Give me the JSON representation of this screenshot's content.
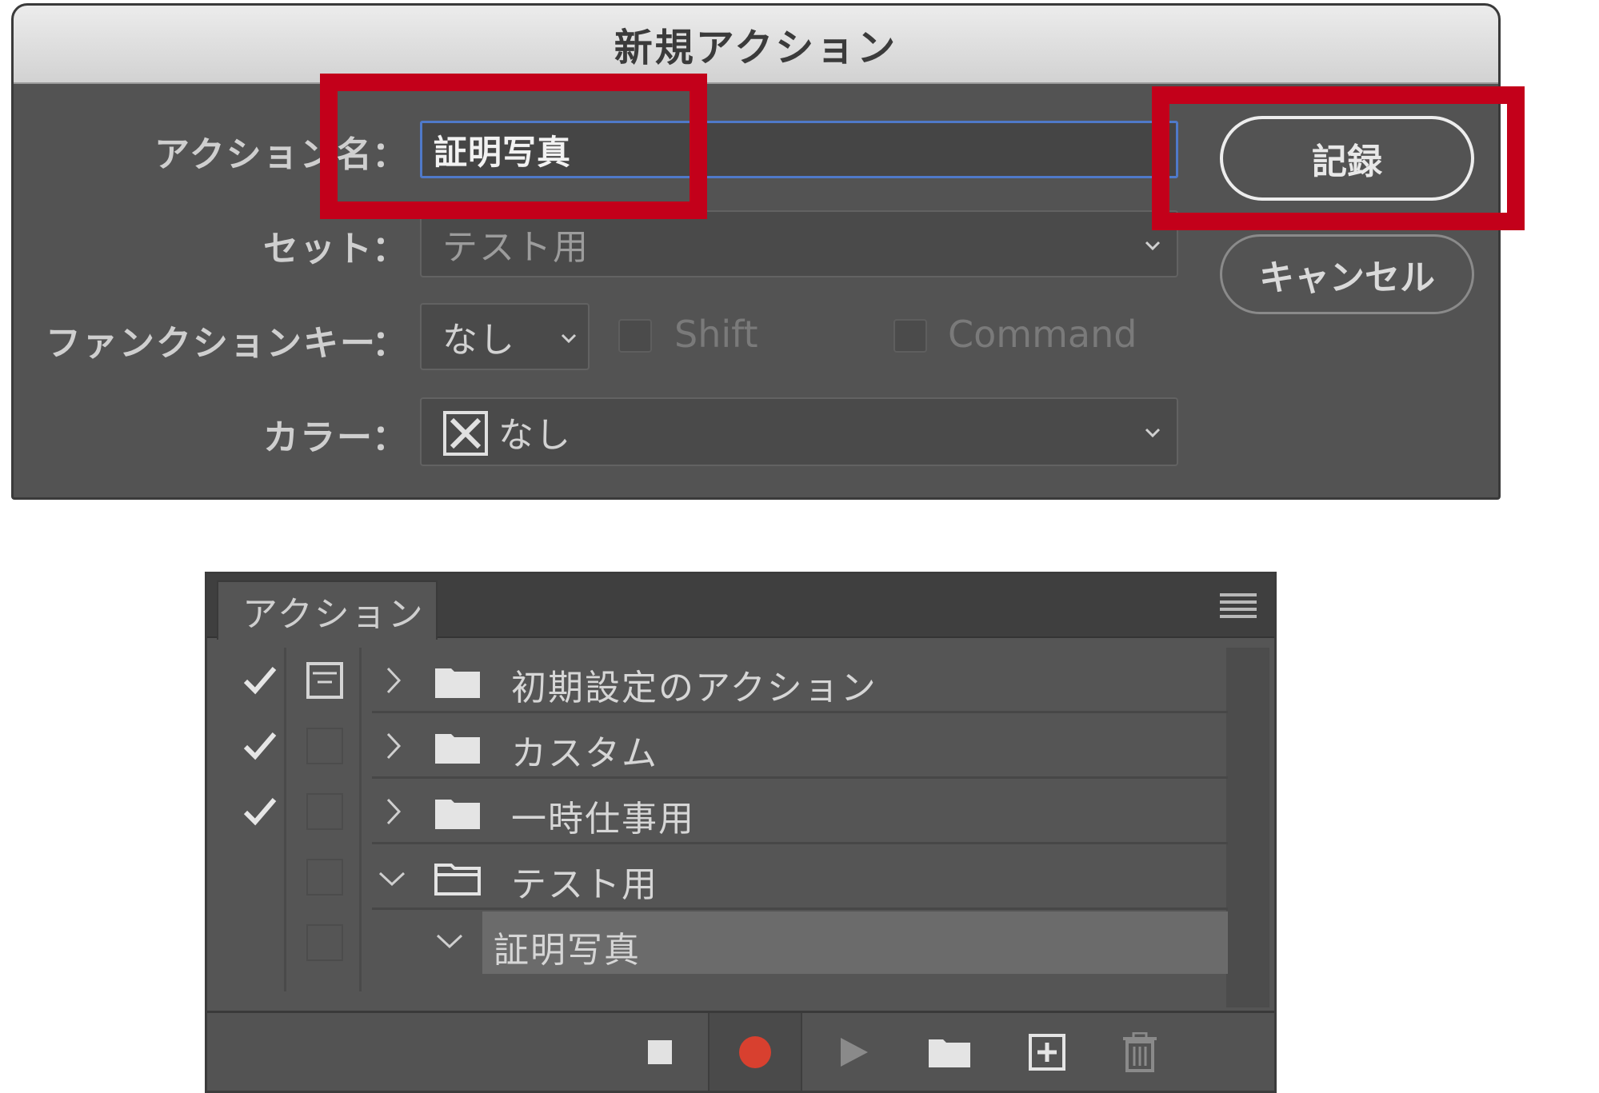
{
  "dialog": {
    "title": "新規アクション",
    "name_label": "アクション名",
    "name_value": "証明写真",
    "set_label": "セット",
    "set_value": "テスト用",
    "function_key_label": "ファンクションキー",
    "function_key_value": "なし",
    "shift_label": "Shift",
    "command_label": "Command",
    "color_label": "カラー",
    "color_value": "なし",
    "colon": "：",
    "record_button": "記録",
    "cancel_button": "キャンセル",
    "highlight_color": "#c3001a",
    "input_focus_color": "#4f79c9"
  },
  "panel": {
    "tab_label": "アクション",
    "rows": [
      {
        "label": "初期設定のアクション",
        "checked": true,
        "dialog_toggle": true,
        "expanded": false,
        "selected": false
      },
      {
        "label": "カスタム",
        "checked": true,
        "dialog_toggle": false,
        "expanded": false,
        "selected": false
      },
      {
        "label": "一時仕事用",
        "checked": true,
        "dialog_toggle": false,
        "expanded": false,
        "selected": false
      },
      {
        "label": "テスト用",
        "checked": false,
        "dialog_toggle": false,
        "expanded": true,
        "selected": false
      },
      {
        "label": "証明写真",
        "checked": false,
        "dialog_toggle": false,
        "expanded": true,
        "selected": true
      }
    ],
    "footer_icons": [
      "stop-icon",
      "record-icon",
      "play-icon",
      "folder-icon",
      "new-action-icon",
      "trash-icon"
    ],
    "record_color": "#d8402f"
  }
}
